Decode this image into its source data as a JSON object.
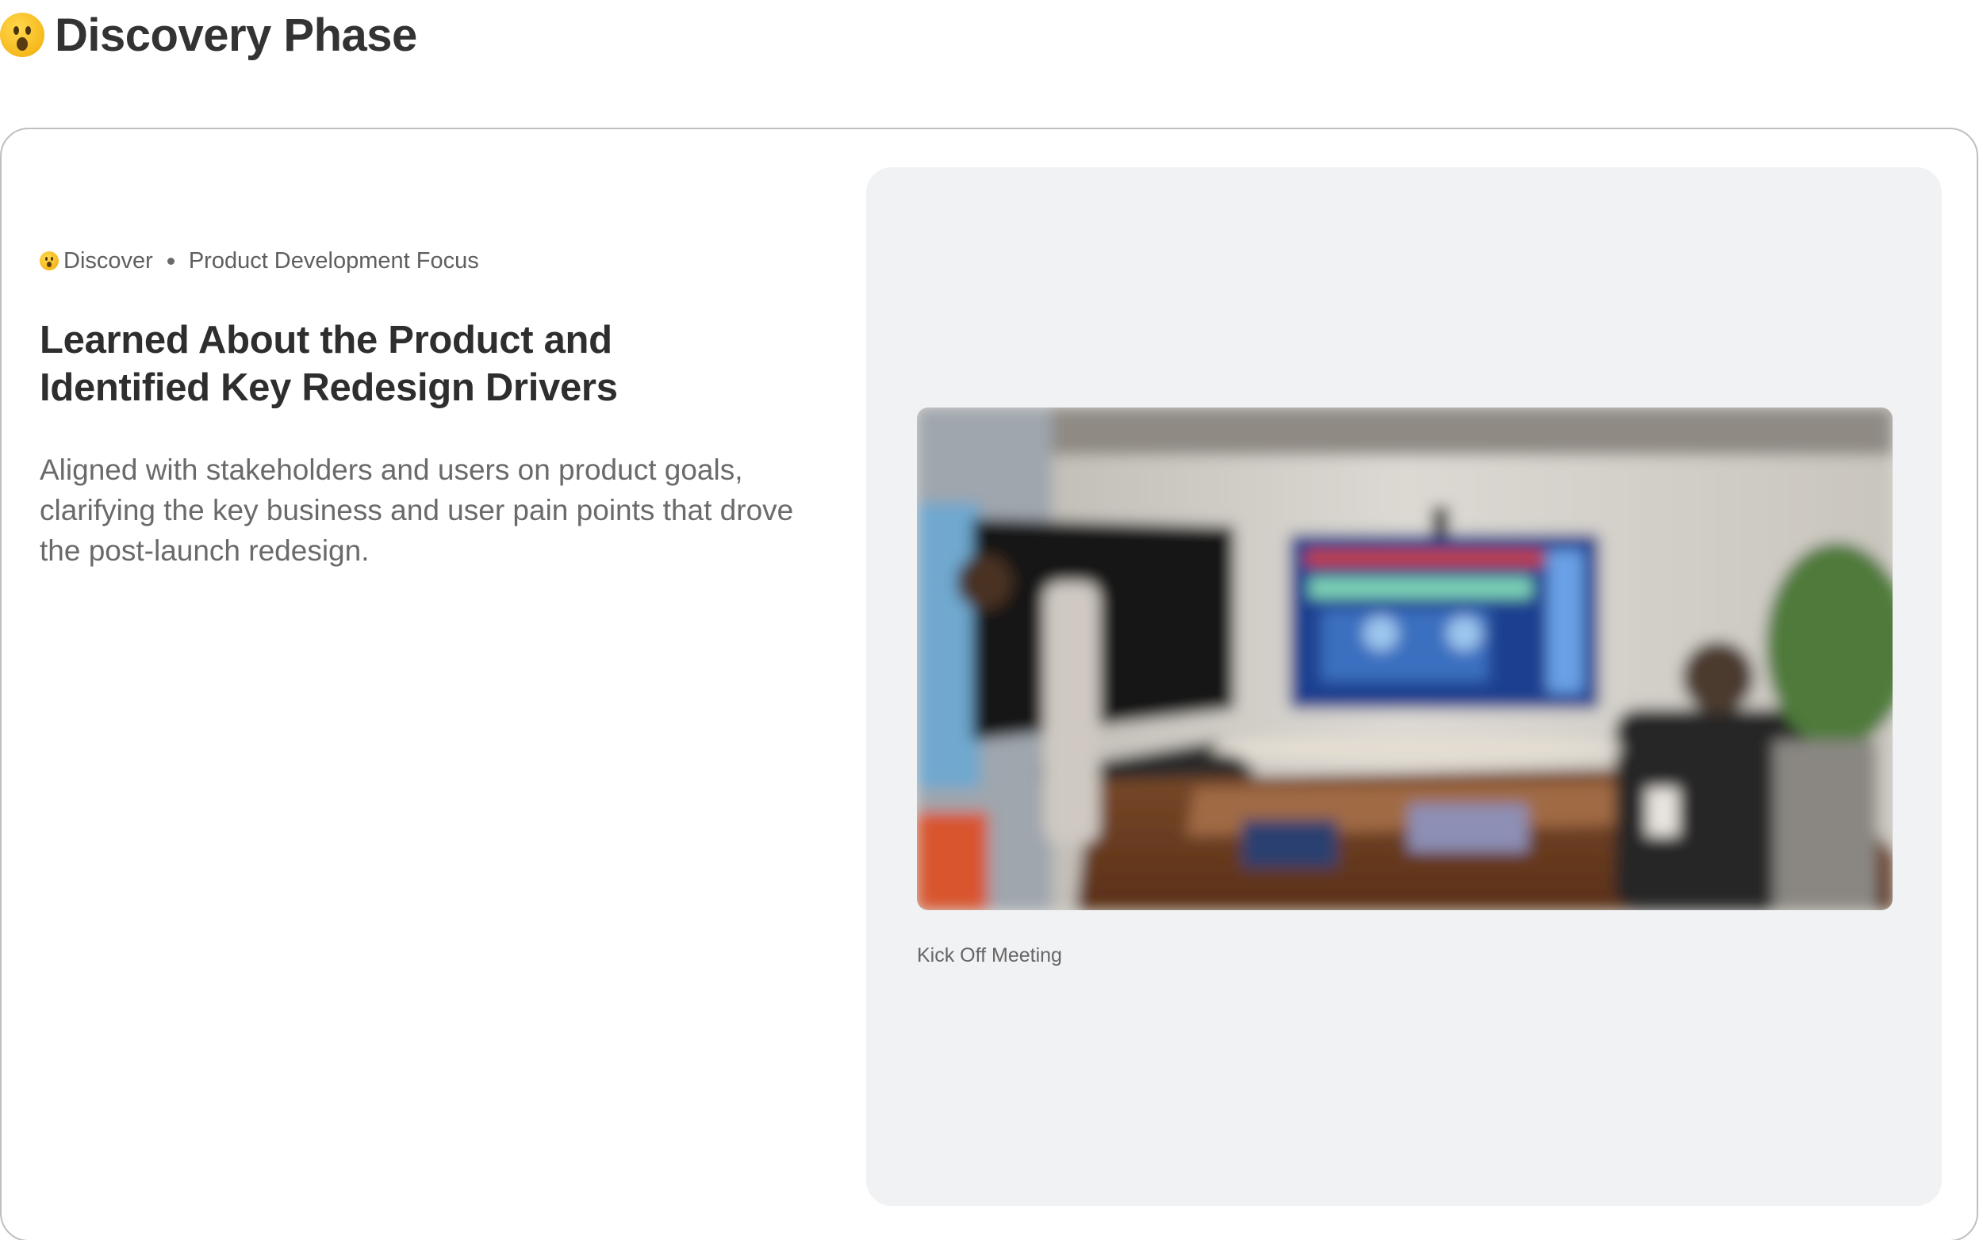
{
  "page": {
    "title": "Discovery Phase",
    "title_icon": "astonished-face-emoji"
  },
  "card": {
    "meta": {
      "icon": "astonished-face-emoji",
      "tag": "Discover",
      "focus": "Product Development Focus"
    },
    "heading": "Learned About the Product and Identified Key Redesign Drivers",
    "description": "Aligned with stakeholders and users on product goals, clarifying the key business and user pain points that drove the post-launch redesign.",
    "media": {
      "caption": "Kick Off Meeting"
    }
  },
  "colors": {
    "card_border": "#bfbfbf",
    "media_panel_bg": "#f1f2f4",
    "heading_text": "#2e2e2e",
    "body_text": "#6a6a6a"
  }
}
